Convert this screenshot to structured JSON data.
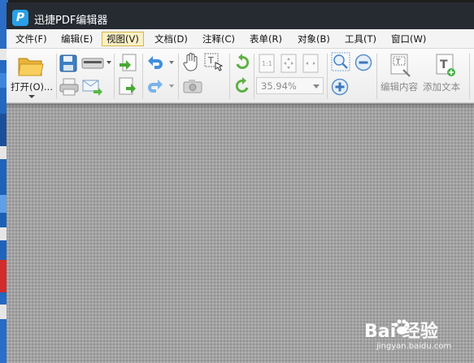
{
  "window": {
    "title": "迅捷PDF编辑器",
    "logo_letter": "P"
  },
  "menu": {
    "items": [
      {
        "label": "文件(F)"
      },
      {
        "label": "编辑(E)"
      },
      {
        "label": "视图(V)",
        "active": true
      },
      {
        "label": "文档(D)"
      },
      {
        "label": "注释(C)"
      },
      {
        "label": "表单(R)"
      },
      {
        "label": "对象(B)"
      },
      {
        "label": "工具(T)"
      },
      {
        "label": "窗口(W)"
      }
    ]
  },
  "toolbar": {
    "open_label": "打开(O)...",
    "zoom_value": "35.94%",
    "edit_content_label": "编辑内容",
    "add_text_label": "添加文本"
  },
  "colors": {
    "titlebar": "#262b32",
    "menubar": "#f4f4f4",
    "active_menu": "#fbf0c5",
    "canvas": "#a2a2a2"
  },
  "watermark": {
    "brand": "Bai  经验",
    "url": "jingyan.baidu.com"
  }
}
